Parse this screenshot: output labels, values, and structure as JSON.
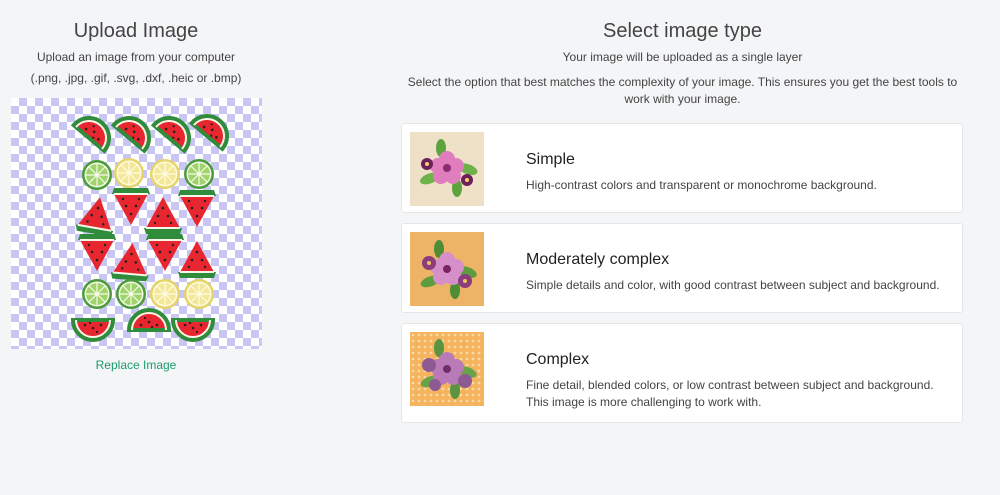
{
  "upload": {
    "title": "Upload Image",
    "subtitle": "Upload an image from your computer",
    "formats": "(.png, .jpg, .gif, .svg, .dxf, .heic or .bmp)",
    "replace_label": "Replace Image"
  },
  "select": {
    "title": "Select image type",
    "intro": "Your image will be uploaded as a single layer",
    "instructions": "Select the option that best matches the complexity of your image. This ensures you get the best tools to work with your image."
  },
  "options": [
    {
      "title": "Simple",
      "description": "High-contrast colors and transparent or monochrome background.",
      "thumb_bg": "#efe1c8"
    },
    {
      "title": "Moderately complex",
      "description": "Simple details and color, with good contrast between subject and background.",
      "thumb_bg": "#edb467"
    },
    {
      "title": "Complex",
      "description": "Fine detail, blended colors, or low contrast between subject and background. This image is more challenging to work with.",
      "thumb_bg": "#f4b35c"
    }
  ],
  "colors": {
    "accent_link": "#1b9a6c",
    "checker": "#c9c6f4",
    "watermelon_red": "#e8262f",
    "rind_green": "#2e8c3a",
    "lime_green": "#9fd36b",
    "lemon_yellow": "#f3e89a"
  }
}
